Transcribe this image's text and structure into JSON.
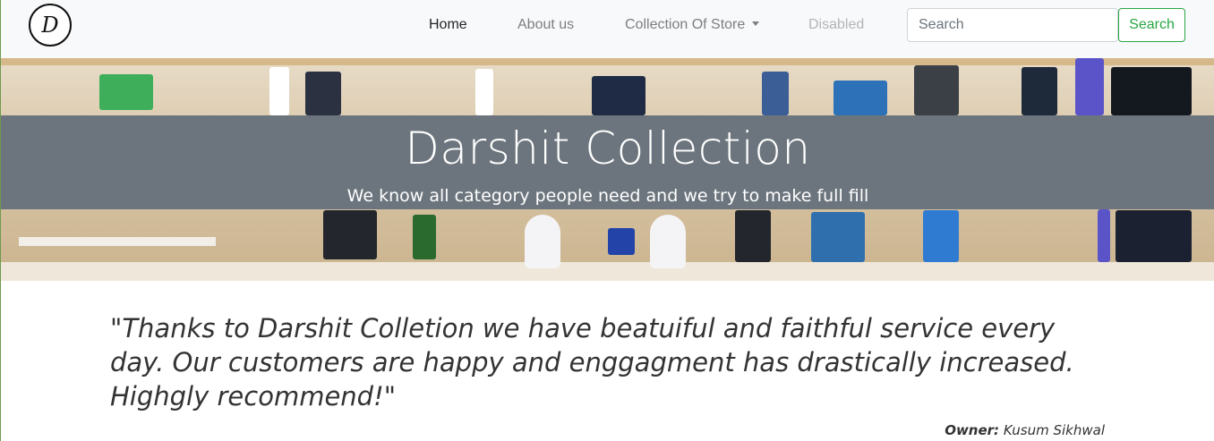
{
  "navbar": {
    "logo_letter": "D",
    "links": [
      {
        "label": "Home",
        "state": "active"
      },
      {
        "label": "About us",
        "state": "normal"
      },
      {
        "label": "Collection Of Store",
        "state": "dropdown"
      },
      {
        "label": "Disabled",
        "state": "disabled"
      }
    ],
    "search": {
      "placeholder": "Search",
      "button_label": "Search"
    }
  },
  "hero": {
    "title": "Darshit Collection",
    "subtitle": "We know all category people need and we try to make full fill"
  },
  "testimonial": {
    "quote": "\"Thanks to Darshit Colletion we have beatuiful and faithful service every day. Our customers are happy and enggagment has drastically increased. Highgly recommend!\"",
    "owner_label": "Owner:",
    "owner_name": "Kusum Sikhwal"
  },
  "colors": {
    "navbar_bg": "#f8f9fa",
    "banner_bg": "#6c757d",
    "search_button": "#28a745",
    "body_text": "#333333"
  }
}
